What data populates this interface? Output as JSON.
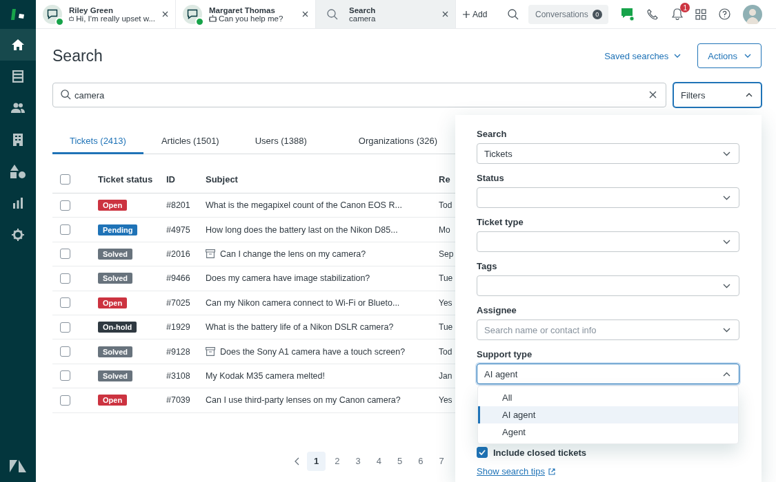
{
  "sidebar": {
    "items": [
      {
        "kind": "home",
        "selected": true
      },
      {
        "kind": "views",
        "selected": false
      },
      {
        "kind": "people",
        "selected": false
      },
      {
        "kind": "building",
        "selected": false
      },
      {
        "kind": "shapes",
        "selected": false
      },
      {
        "kind": "reports",
        "selected": false
      },
      {
        "kind": "settings",
        "selected": false
      }
    ]
  },
  "top_tabs": [
    {
      "kind": "chat",
      "title": "Riley Green",
      "subtitle": "Hi, I'm really upset w...",
      "online": true,
      "selected": false
    },
    {
      "kind": "chat",
      "title": "Margaret Thomas",
      "subtitle": "Can you help me?",
      "online": true,
      "selected": false
    },
    {
      "kind": "search",
      "title": "Search",
      "subtitle": "camera",
      "selected": true
    }
  ],
  "toolbar": {
    "add": "Add",
    "conversations": "Conversations",
    "conversations_count": "0",
    "notifications": "1"
  },
  "page": {
    "title": "Search",
    "saved_searches": "Saved searches",
    "actions": "Actions",
    "search_value": "camera",
    "filters": "Filters"
  },
  "result_tabs": [
    {
      "label": "Tickets (2413)",
      "selected": true
    },
    {
      "label": "Articles (1501)",
      "selected": false
    },
    {
      "label": "Users (1388)",
      "selected": false
    },
    {
      "label": "Organizations (326)",
      "selected": false
    }
  ],
  "table": {
    "select_all_checked": false,
    "columns": [
      "Ticket status",
      "ID",
      "Subject",
      "Re"
    ],
    "rows": [
      {
        "checked": false,
        "status": "Open",
        "color": "#cc3340",
        "id": "#8201",
        "subject": "What is the megapixel count of the Canon EOS R...",
        "archived": false,
        "column_4": "Tod"
      },
      {
        "checked": false,
        "status": "Pending",
        "color": "#1f73b7",
        "id": "#4975",
        "subject": "How long does the battery last on the Nikon D85...",
        "archived": false,
        "column_4": "Mo"
      },
      {
        "checked": false,
        "status": "Solved",
        "color": "#68737d",
        "id": "#2016",
        "subject": "Can I change the lens on my camera?",
        "archived": true,
        "column_4": "Sep"
      },
      {
        "checked": false,
        "status": "Solved",
        "color": "#68737d",
        "id": "#9466",
        "subject": "Does my camera have image stabilization?",
        "archived": false,
        "column_4": "Tue"
      },
      {
        "checked": false,
        "status": "Open",
        "color": "#cc3340",
        "id": "#7025",
        "subject": "Can my Nikon camera connect to Wi-Fi or Blueto...",
        "archived": false,
        "column_4": "Yes"
      },
      {
        "checked": false,
        "status": "On-hold",
        "color": "#2f3941",
        "id": "#1929",
        "subject": "What is the battery life of a Nikon DSLR camera?",
        "archived": false,
        "column_4": "Tue"
      },
      {
        "checked": false,
        "status": "Solved",
        "color": "#68737d",
        "id": "#9128",
        "subject": "Does the Sony A1 camera have a touch screen?",
        "archived": true,
        "column_4": "Tod"
      },
      {
        "checked": false,
        "status": "Solved",
        "color": "#68737d",
        "id": "#3108",
        "subject": "My Kodak M35 camera melted!",
        "archived": false,
        "column_4": "Jan"
      },
      {
        "checked": false,
        "status": "Open",
        "color": "#cc3340",
        "id": "#7039",
        "subject": "Can I use third-party lenses on my Canon camera?",
        "archived": false,
        "column_4": "Yes"
      }
    ]
  },
  "pagination": {
    "pages": [
      {
        "label": "1",
        "selected": true
      },
      {
        "label": "2",
        "selected": false
      },
      {
        "label": "3",
        "selected": false
      },
      {
        "label": "4",
        "selected": false
      },
      {
        "label": "5",
        "selected": false
      },
      {
        "label": "6",
        "selected": false
      },
      {
        "label": "7",
        "selected": false
      }
    ]
  },
  "filters": {
    "fields": [
      {
        "label": "Search",
        "value": "Tickets",
        "expanded": false
      },
      {
        "label": "Status",
        "expanded": false
      },
      {
        "label": "Ticket type",
        "expanded": false
      },
      {
        "label": "Tags",
        "expanded": false
      },
      {
        "label": "Assignee",
        "placeholder": "Search name or contact info",
        "expanded": false
      },
      {
        "label": "Support type",
        "value": "AI agent",
        "expanded": true
      }
    ],
    "options": [
      {
        "label": "All",
        "selected": false
      },
      {
        "label": "AI agent",
        "selected": true
      },
      {
        "label": "Agent",
        "selected": false
      }
    ],
    "include_closed": {
      "label": "Include closed tickets",
      "checked": true
    },
    "tips_link": "Show search tips"
  }
}
